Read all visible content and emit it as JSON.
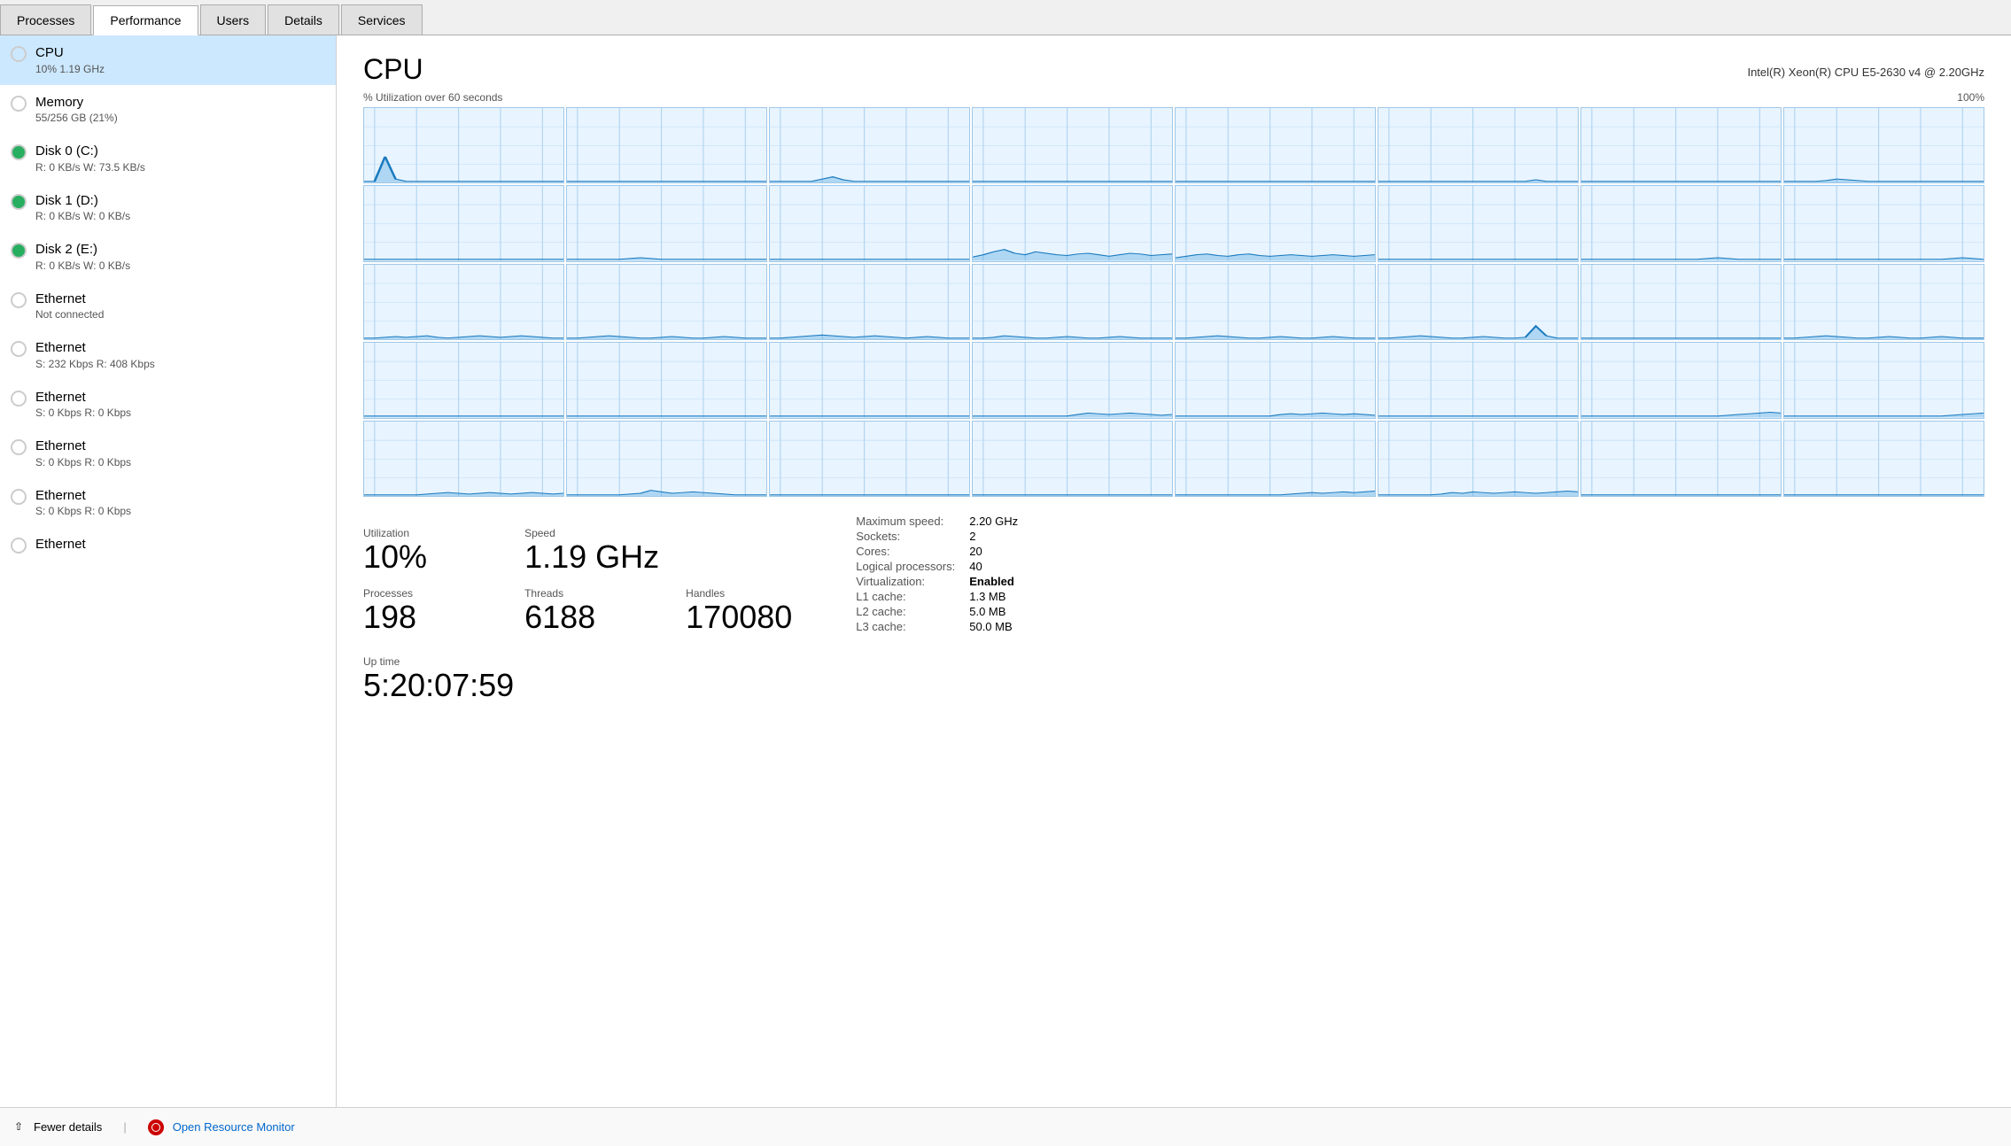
{
  "tabs": [
    {
      "label": "Processes",
      "active": false
    },
    {
      "label": "Performance",
      "active": true
    },
    {
      "label": "Users",
      "active": false
    },
    {
      "label": "Details",
      "active": false
    },
    {
      "label": "Services",
      "active": false
    }
  ],
  "sidebar": {
    "items": [
      {
        "name": "CPU",
        "sub": "10% 1.19 GHz",
        "circle": "circle-blue",
        "active": true
      },
      {
        "name": "Memory",
        "sub": "55/256 GB (21%)",
        "circle": "circle-purple",
        "active": false
      },
      {
        "name": "Disk 0 (C:)",
        "sub": "R: 0 KB/s W: 73.5 KB/s",
        "circle": "circle-green-disk",
        "active": false
      },
      {
        "name": "Disk 1 (D:)",
        "sub": "R: 0 KB/s W: 0 KB/s",
        "circle": "circle-green-disk",
        "active": false
      },
      {
        "name": "Disk 2 (E:)",
        "sub": "R: 0 KB/s W: 0 KB/s",
        "circle": "circle-green-disk",
        "active": false
      },
      {
        "name": "Ethernet",
        "sub": "Not connected",
        "circle": "circle-gray",
        "active": false
      },
      {
        "name": "Ethernet",
        "sub": "S: 232 Kbps R: 408 Kbps",
        "circle": "circle-orange",
        "active": false
      },
      {
        "name": "Ethernet",
        "sub": "S: 0 Kbps R: 0 Kbps",
        "circle": "circle-orange",
        "active": false
      },
      {
        "name": "Ethernet",
        "sub": "S: 0 Kbps R: 0 Kbps",
        "circle": "circle-orange",
        "active": false
      },
      {
        "name": "Ethernet",
        "sub": "S: 0 Kbps R: 0 Kbps",
        "circle": "circle-orange",
        "active": false
      },
      {
        "name": "Ethernet",
        "sub": "",
        "circle": "circle-orange",
        "active": false
      }
    ]
  },
  "cpu": {
    "title": "CPU",
    "model": "Intel(R) Xeon(R) CPU E5-2630 v4 @ 2.20GHz",
    "chart_label": "% Utilization over 60 seconds",
    "chart_max": "100%",
    "utilization_label": "Utilization",
    "utilization_value": "10%",
    "speed_label": "Speed",
    "speed_value": "1.19 GHz",
    "processes_label": "Processes",
    "processes_value": "198",
    "threads_label": "Threads",
    "threads_value": "6188",
    "handles_label": "Handles",
    "handles_value": "170080",
    "uptime_label": "Up time",
    "uptime_value": "5:20:07:59",
    "specs": [
      {
        "key": "Maximum speed:",
        "value": "2.20 GHz",
        "bold": false
      },
      {
        "key": "Sockets:",
        "value": "2",
        "bold": false
      },
      {
        "key": "Cores:",
        "value": "20",
        "bold": false
      },
      {
        "key": "Logical processors:",
        "value": "40",
        "bold": false
      },
      {
        "key": "Virtualization:",
        "value": "Enabled",
        "bold": true
      },
      {
        "key": "L1 cache:",
        "value": "1.3 MB",
        "bold": false
      },
      {
        "key": "L2 cache:",
        "value": "5.0 MB",
        "bold": false
      },
      {
        "key": "L3 cache:",
        "value": "50.0 MB",
        "bold": false
      }
    ]
  },
  "bottom": {
    "fewer_details": "Fewer details",
    "open_resource_monitor": "Open Resource Monitor"
  }
}
